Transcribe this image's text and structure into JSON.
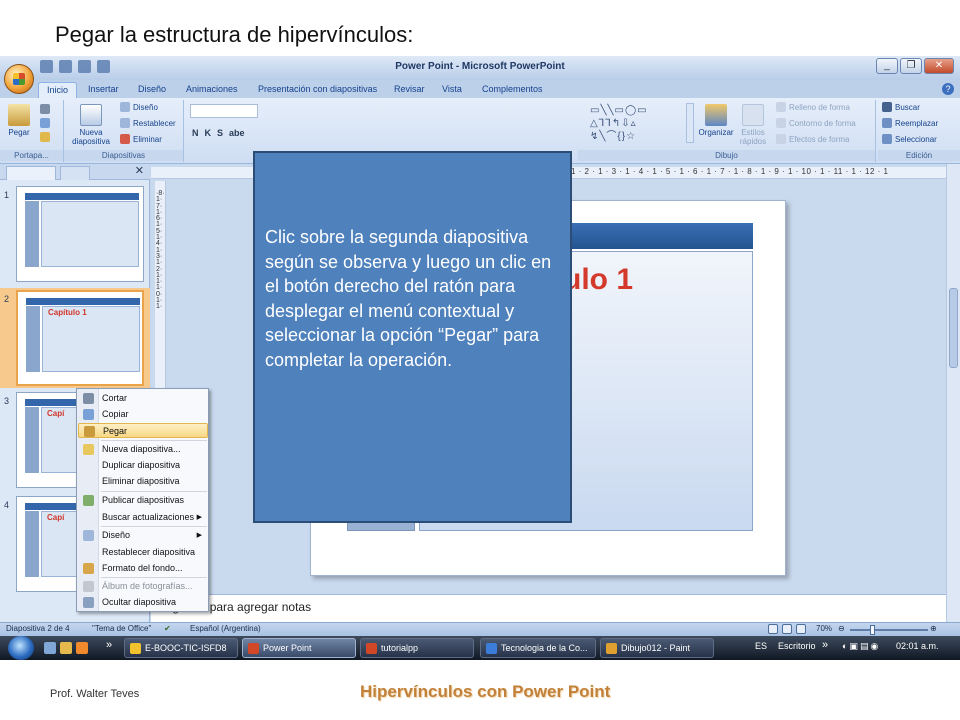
{
  "page": {
    "heading": "Pegar la estructura de hipervínculos:",
    "footer_author": "Prof. Walter Teves",
    "footer_title": "Hipervínculos con Power Point"
  },
  "window": {
    "title": "Power Point - Microsoft PowerPoint",
    "buttons": [
      "_",
      "❐",
      "✕"
    ]
  },
  "tabs": [
    "Inicio",
    "Insertar",
    "Diseño",
    "Animaciones",
    "Presentación con diapositivas",
    "Revisar",
    "Vista",
    "Complementos"
  ],
  "ribbon": {
    "paste": "Pegar",
    "portapapeles": "Portapa...",
    "nueva": "Nueva",
    "diapositiva": "diapositiva",
    "diseno": "Diseño",
    "restablecer": "Restablecer",
    "eliminar": "Eliminar",
    "diapositivas_label": "Diapositivas",
    "format_letters": [
      "N",
      "K",
      "S",
      "abe"
    ],
    "organizar": "Organizar",
    "estilos": "Estilos",
    "rapidos": "rápidos",
    "relleno": "Relleno de forma",
    "contorno": "Contorno de forma",
    "efectos": "Efectos de forma",
    "dibujo_label": "Dibujo",
    "buscar": "Buscar",
    "reemplazar": "Reemplazar",
    "seleccionar": "Seleccionar",
    "edicion_label": "Edición",
    "shapes_row1": "▭╲╲▭◯▭",
    "shapes_row2": "△⅂⅂↰⇩▵",
    "shapes_row3": "↯╲⌒{}☆"
  },
  "ruler_top": "1 · 2 · 1 · 3 · 1 · 4 · 1 · 5 · 1 · 6 · 1 · 7 · 1 · 8 · 1 · 9 · 1 · 10 · 1 · 11 · 1 · 12 · 1",
  "ruler_left": "·8·1·7·1·6·1·5·1·4·1·3·1·2·1·1·1·0·1·1·",
  "thumbnails": [
    {
      "num": "1",
      "caption": ""
    },
    {
      "num": "2",
      "caption": "Capítulo 1"
    },
    {
      "num": "3",
      "caption": "Capí"
    },
    {
      "num": "4",
      "caption": "Capí"
    }
  ],
  "slide": {
    "caption": "ulo 1"
  },
  "notes_placeholder": "Haga clic para agregar notas",
  "status": {
    "slide_of": "Diapositiva 2 de 4",
    "theme": "\"Tema de Office\"",
    "language": "Español (Argentina)",
    "zoom": "70%"
  },
  "context_menu": [
    {
      "label": "Cortar",
      "highlight": false,
      "disabled": false,
      "submenu": false
    },
    {
      "label": "Copiar",
      "highlight": false,
      "disabled": false,
      "submenu": false
    },
    {
      "label": "Pegar",
      "highlight": true,
      "disabled": false,
      "submenu": false
    },
    {
      "label": "Nueva diapositiva...",
      "highlight": false,
      "disabled": false,
      "submenu": false
    },
    {
      "label": "Duplicar diapositiva",
      "highlight": false,
      "disabled": false,
      "submenu": false
    },
    {
      "label": "Eliminar diapositiva",
      "highlight": false,
      "disabled": false,
      "submenu": false
    },
    {
      "label": "Publicar diapositivas",
      "highlight": false,
      "disabled": false,
      "submenu": false
    },
    {
      "label": "Buscar actualizaciones",
      "highlight": false,
      "disabled": false,
      "submenu": true
    },
    {
      "label": "Diseño",
      "highlight": false,
      "disabled": false,
      "submenu": true
    },
    {
      "label": "Restablecer diapositiva",
      "highlight": false,
      "disabled": false,
      "submenu": false
    },
    {
      "label": "Formato del fondo...",
      "highlight": false,
      "disabled": false,
      "submenu": false
    },
    {
      "label": "Álbum de fotografías...",
      "highlight": false,
      "disabled": true,
      "submenu": false
    },
    {
      "label": "Ocultar diapositiva",
      "highlight": false,
      "disabled": false,
      "submenu": false
    }
  ],
  "callout": {
    "text": "Clic sobre la segunda diapositiva según se observa y luego un clic en el botón derecho del ratón para desplegar el menú contextual y seleccionar la opción “Pegar” para completar la operación."
  },
  "taskbar": {
    "chevron": "»",
    "tasks": [
      {
        "label": "E-BOOC-TIC-ISFD8",
        "active": false,
        "color": "#f2c12e"
      },
      {
        "label": "Power Point",
        "active": true,
        "color": "#d24726"
      },
      {
        "label": "tutorialpp",
        "active": false,
        "color": "#d24726"
      },
      {
        "label": "Tecnologia de la Co...",
        "active": false,
        "color": "#3b7dd8"
      },
      {
        "label": "Dibujo012 - Paint",
        "active": false,
        "color": "#e0a030"
      }
    ],
    "lang": "ES",
    "desktop": "Escritorio",
    "time": "02:01 a.m."
  },
  "colors": {
    "callout_fill": "#4f81bd",
    "selection": "#f8d784",
    "footer_title": "#c2813a"
  },
  "icons": [
    "office-button-icon",
    "paste-icon",
    "cut-icon",
    "copy-icon",
    "windows-start-icon",
    "help-icon"
  ]
}
